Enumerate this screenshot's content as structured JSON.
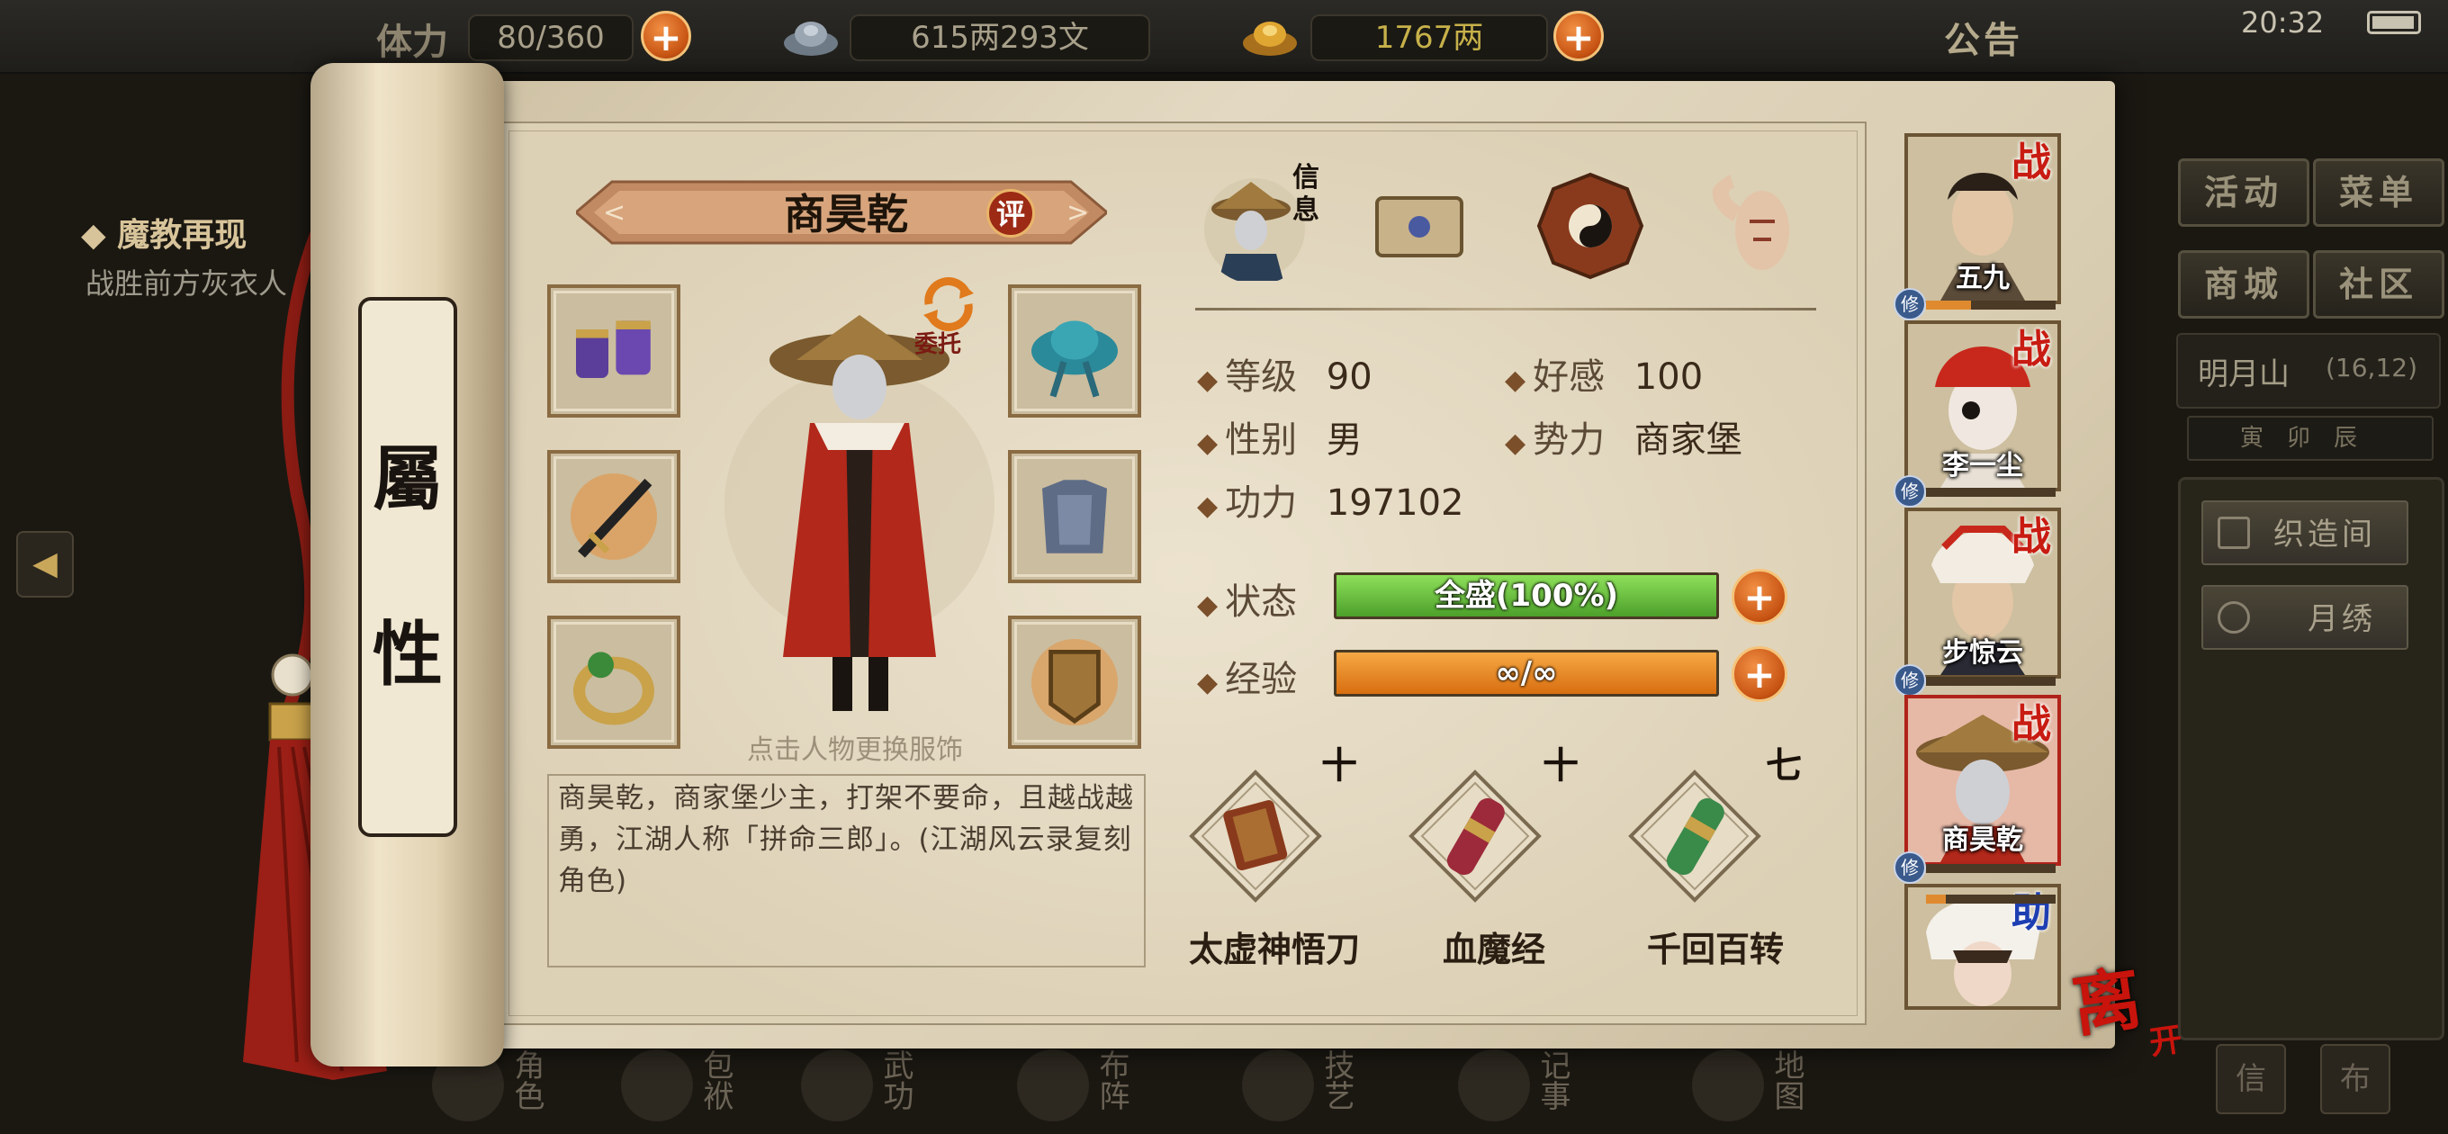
{
  "hud": {
    "stamina_label": "体力",
    "stamina_value": "80/360",
    "silver_value": "615两293文",
    "gold_value": "1767两",
    "notice_label": "公告",
    "clock": "20:32"
  },
  "quest": {
    "title": "◆ 魔教再现",
    "subtitle": "战胜前方灰衣人"
  },
  "right_menu": {
    "activity": "活动",
    "menu": "菜单",
    "mall": "商城",
    "community": "社区",
    "location_name": "明月山",
    "location_coord": "(16,12)",
    "time_tabs": "寅卯辰",
    "weaving": "织造间",
    "embroidery": "月绣"
  },
  "bottom_nav": [
    "角色",
    "包袱",
    "武功",
    "布阵",
    "技艺",
    "记事",
    "地图"
  ],
  "scroll": {
    "char1": "屬",
    "char2": "性"
  },
  "character": {
    "name": "商昊乾",
    "eval_label": "评",
    "delegate_label": "委托",
    "hint": "点击人物更换服饰",
    "description": "商昊乾，商家堡少主，打架不要命，且越战越勇，江湖人称「拼命三郎」。(江湖风云录复刻角色)"
  },
  "tabs": {
    "info_label": "信息",
    "icons": [
      "info-portrait-icon",
      "scroll-map-icon",
      "bagua-icon",
      "muscle-icon"
    ]
  },
  "stats": {
    "level_label": "等级",
    "level_value": "90",
    "favor_label": "好感",
    "favor_value": "100",
    "gender_label": "性别",
    "gender_value": "男",
    "faction_label": "势力",
    "faction_value": "商家堡",
    "power_label": "功力",
    "power_value": "197102",
    "status_label": "状态",
    "status_bar_text": "全盛(100%)",
    "status_fraction": 1.0,
    "exp_label": "经验",
    "exp_bar_text": "∞/∞",
    "exp_fraction": 1.0
  },
  "skills": [
    {
      "name": "太虚神悟刀",
      "rank": "十",
      "icon": "blade-manual-icon"
    },
    {
      "name": "血魔经",
      "rank": "十",
      "icon": "blood-scroll-icon"
    },
    {
      "name": "千回百转",
      "rank": "七",
      "icon": "green-scroll-icon"
    }
  ],
  "roster": [
    {
      "name": "五九",
      "role": "战",
      "xp_fraction": 0.35
    },
    {
      "name": "李一尘",
      "role": "战",
      "xp_fraction": 0.0
    },
    {
      "name": "步惊云",
      "role": "战",
      "xp_fraction": 0.0
    },
    {
      "name": "商昊乾",
      "role": "战",
      "xp_fraction": 0.0,
      "selected": true
    },
    {
      "name": "",
      "role": "助",
      "xp_fraction": 0.15
    }
  ],
  "xiu_label": "修",
  "leave": {
    "main": "离",
    "sub": "开"
  },
  "colors": {
    "status_fill": "#6ec23c",
    "exp_fill": "#e9861c",
    "accent_red": "#c81c12",
    "parchment": "#e3d9c2"
  }
}
